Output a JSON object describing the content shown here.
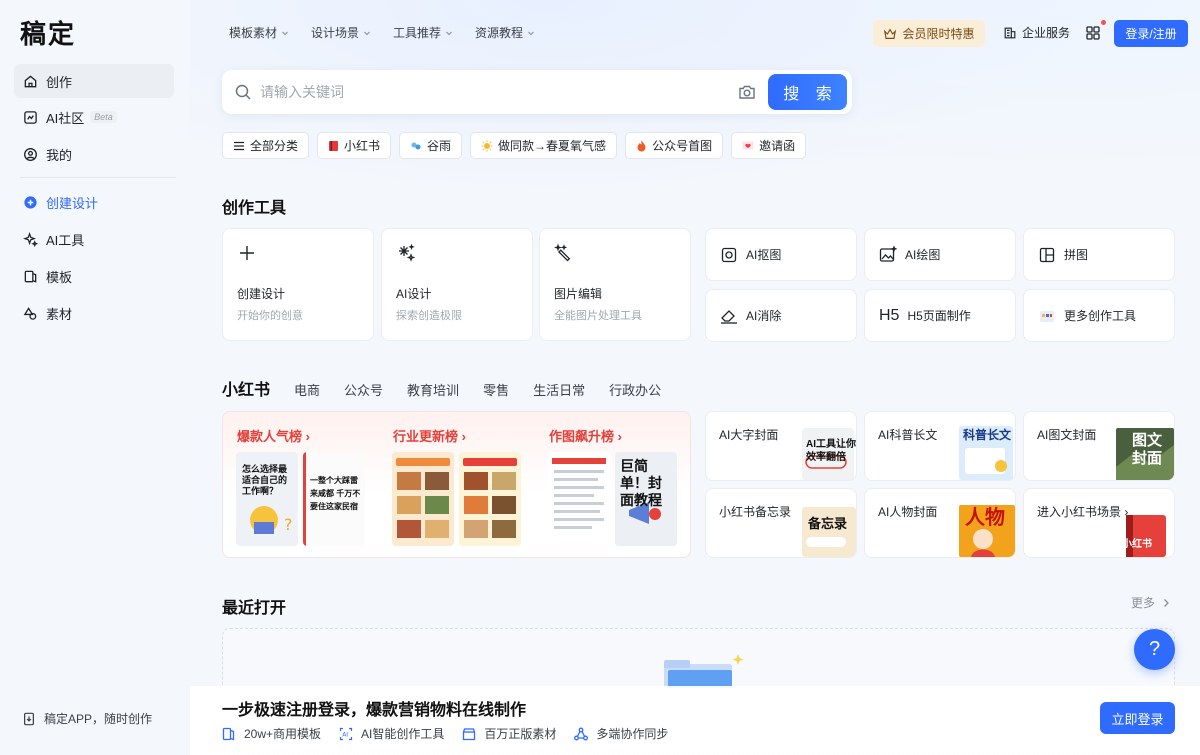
{
  "brand": {
    "logo": "稿定"
  },
  "sidebar": {
    "items": [
      {
        "label": "创作",
        "icon": "home-icon"
      },
      {
        "label": "AI社区",
        "badge": "Beta",
        "icon": "ai-community-icon"
      },
      {
        "label": "我的",
        "icon": "user-icon"
      },
      {
        "label": "创建设计",
        "icon": "plus-circle-icon"
      },
      {
        "label": "AI工具",
        "icon": "sparkle-icon"
      },
      {
        "label": "模板",
        "icon": "template-icon"
      },
      {
        "label": "素材",
        "icon": "shapes-icon"
      }
    ],
    "app_link": "稿定APP，随时创作"
  },
  "topnav": {
    "items": [
      "模板素材",
      "设计场景",
      "工具推荐",
      "资源教程"
    ],
    "vip": "会员限时特惠",
    "enterprise": "企业服务",
    "login": "登录/注册"
  },
  "search": {
    "placeholder": "请输入关键词",
    "button": "搜 索"
  },
  "chips": [
    {
      "label": "全部分类",
      "icon": "menu-icon"
    },
    {
      "label": "小红书",
      "icon": "red-book-icon"
    },
    {
      "label": "谷雨",
      "icon": "rain-icon"
    },
    {
      "label": "做同款→春夏氧气感",
      "icon": "sun-icon"
    },
    {
      "label": "公众号首图",
      "icon": "fire-icon"
    },
    {
      "label": "邀请函",
      "icon": "heart-letter-icon"
    }
  ],
  "create_tools": {
    "title": "创作工具",
    "big": [
      {
        "title": "创建设计",
        "sub": "开始你的创意"
      },
      {
        "title": "AI设计",
        "sub": "探索创造极限"
      },
      {
        "title": "图片编辑",
        "sub": "全能图片处理工具"
      }
    ],
    "small": [
      "AI抠图",
      "AI绘图",
      "拼图",
      "AI消除",
      "H5页面制作",
      "更多创作工具"
    ]
  },
  "xhs": {
    "title": "小红书",
    "tabs": [
      "电商",
      "公众号",
      "教育培训",
      "零售",
      "生活日常",
      "行政办公"
    ],
    "ranks": [
      "爆款人气榜 ›",
      "行业更新榜 ›",
      "作图飙升榜 ›"
    ],
    "thumb_text": {
      "t1": "怎么选择最适合自己的工作啊？",
      "t2": "一整个大踩雷来咸都 千万不要住这家民宿",
      "t5": "巨简单！封面教程"
    },
    "cards": [
      {
        "label": "AI大字封面",
        "art": "AI工具让你效率翻倍"
      },
      {
        "label": "AI科普长文",
        "art": "科普长文"
      },
      {
        "label": "AI图文封面",
        "art": "图文封面"
      },
      {
        "label": "小红书备忘录",
        "art": "备忘录"
      },
      {
        "label": "AI人物封面",
        "art": "人物"
      },
      {
        "label": "进入小红书场景 ›",
        "art": "小红书"
      }
    ]
  },
  "recent": {
    "title": "最近打开",
    "more": "更多"
  },
  "register": {
    "title": "一步极速注册登录，爆款营销物料在线制作",
    "features": [
      "20w+商用模板",
      "AI智能创作工具",
      "百万正版素材",
      "多端协作同步"
    ],
    "button": "立即登录"
  },
  "help": "?",
  "colors": {
    "accent": "#2f6bff",
    "rank_red": "#e5403a",
    "vip_bg": "#fbeed8"
  }
}
